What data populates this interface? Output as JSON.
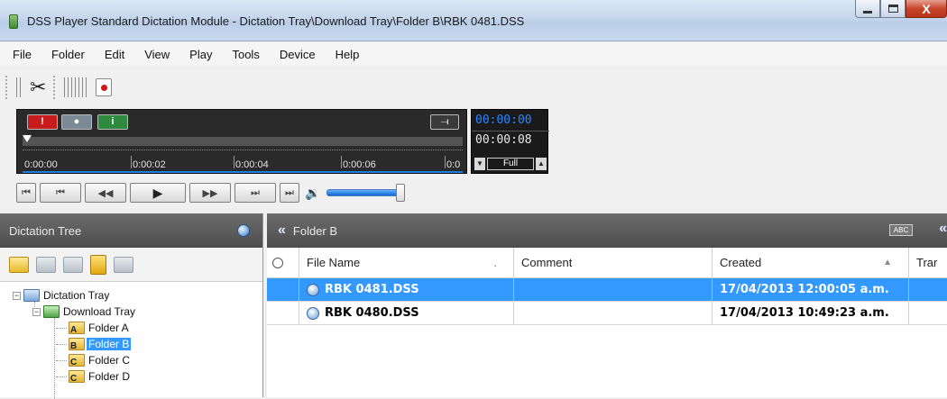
{
  "window": {
    "title": "DSS Player Standard Dictation Module - Dictation Tray\\Download Tray\\Folder B\\RBK 0481.DSS",
    "close_glyph": "X"
  },
  "menu": [
    "File",
    "Folder",
    "Edit",
    "View",
    "Play",
    "Tools",
    "Device",
    "Help"
  ],
  "player": {
    "ticks": [
      "0:00:00",
      "0:00:02",
      "0:00:04",
      "0:00:06",
      "0:0"
    ],
    "current_time": "00:00:00",
    "total_time": "00:00:08",
    "speed_label": "Full",
    "volume": 1.0
  },
  "dictation_tree": {
    "header": "Dictation Tree",
    "nodes": [
      {
        "label": "Dictation Tray",
        "level": 0
      },
      {
        "label": "Download Tray",
        "level": 1
      },
      {
        "label": "Folder A",
        "level": 2,
        "letter": "A"
      },
      {
        "label": "Folder B",
        "level": 2,
        "letter": "B",
        "selected": true
      },
      {
        "label": "Folder C",
        "level": 2,
        "letter": "C"
      },
      {
        "label": "Folder D",
        "level": 2,
        "letter": "C"
      }
    ]
  },
  "file_list": {
    "header": "Folder B",
    "abc_label": "ABC",
    "columns": [
      "File Name",
      "Comment",
      "Created",
      "Trar"
    ],
    "rows": [
      {
        "file": "RBK 0481.DSS",
        "comment": "",
        "created": "17/04/2013 12:00:05 a.m.",
        "selected": true
      },
      {
        "file": "RBK 0480.DSS",
        "comment": "",
        "created": "17/04/2013 10:49:23 a.m.",
        "selected": false
      }
    ]
  },
  "colors": {
    "selection": "#3399ff",
    "header_bg": "#555555",
    "player_bg": "#2a2a2a",
    "time_blue": "#2a86ff"
  }
}
